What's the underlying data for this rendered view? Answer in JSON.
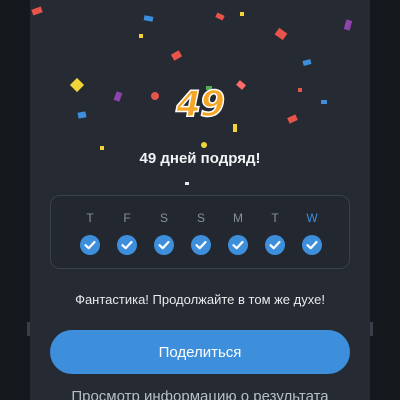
{
  "streak": {
    "count": "49",
    "title": "49 дней подряд!"
  },
  "week": {
    "days": [
      {
        "label": "T",
        "completed": true,
        "current": false
      },
      {
        "label": "F",
        "completed": true,
        "current": false
      },
      {
        "label": "S",
        "completed": true,
        "current": false
      },
      {
        "label": "S",
        "completed": true,
        "current": false
      },
      {
        "label": "M",
        "completed": true,
        "current": false
      },
      {
        "label": "T",
        "completed": true,
        "current": false
      },
      {
        "label": "W",
        "completed": true,
        "current": true
      }
    ]
  },
  "message": "Фантастика! Продолжайте в том же духе!",
  "share_button_label": "Поделиться",
  "results_link_label": "Просмотр информацию о результата",
  "colors": {
    "background": "#252a33",
    "accent": "#3d8fdc",
    "streak_number": "#f5a623",
    "confetti": [
      "#3d8fdc",
      "#e8534a",
      "#f5a623",
      "#8e44ad",
      "#f0d43a",
      "#4caf50",
      "#ff6b6b"
    ]
  },
  "icons": {
    "day_check": "checkmark-icon"
  }
}
